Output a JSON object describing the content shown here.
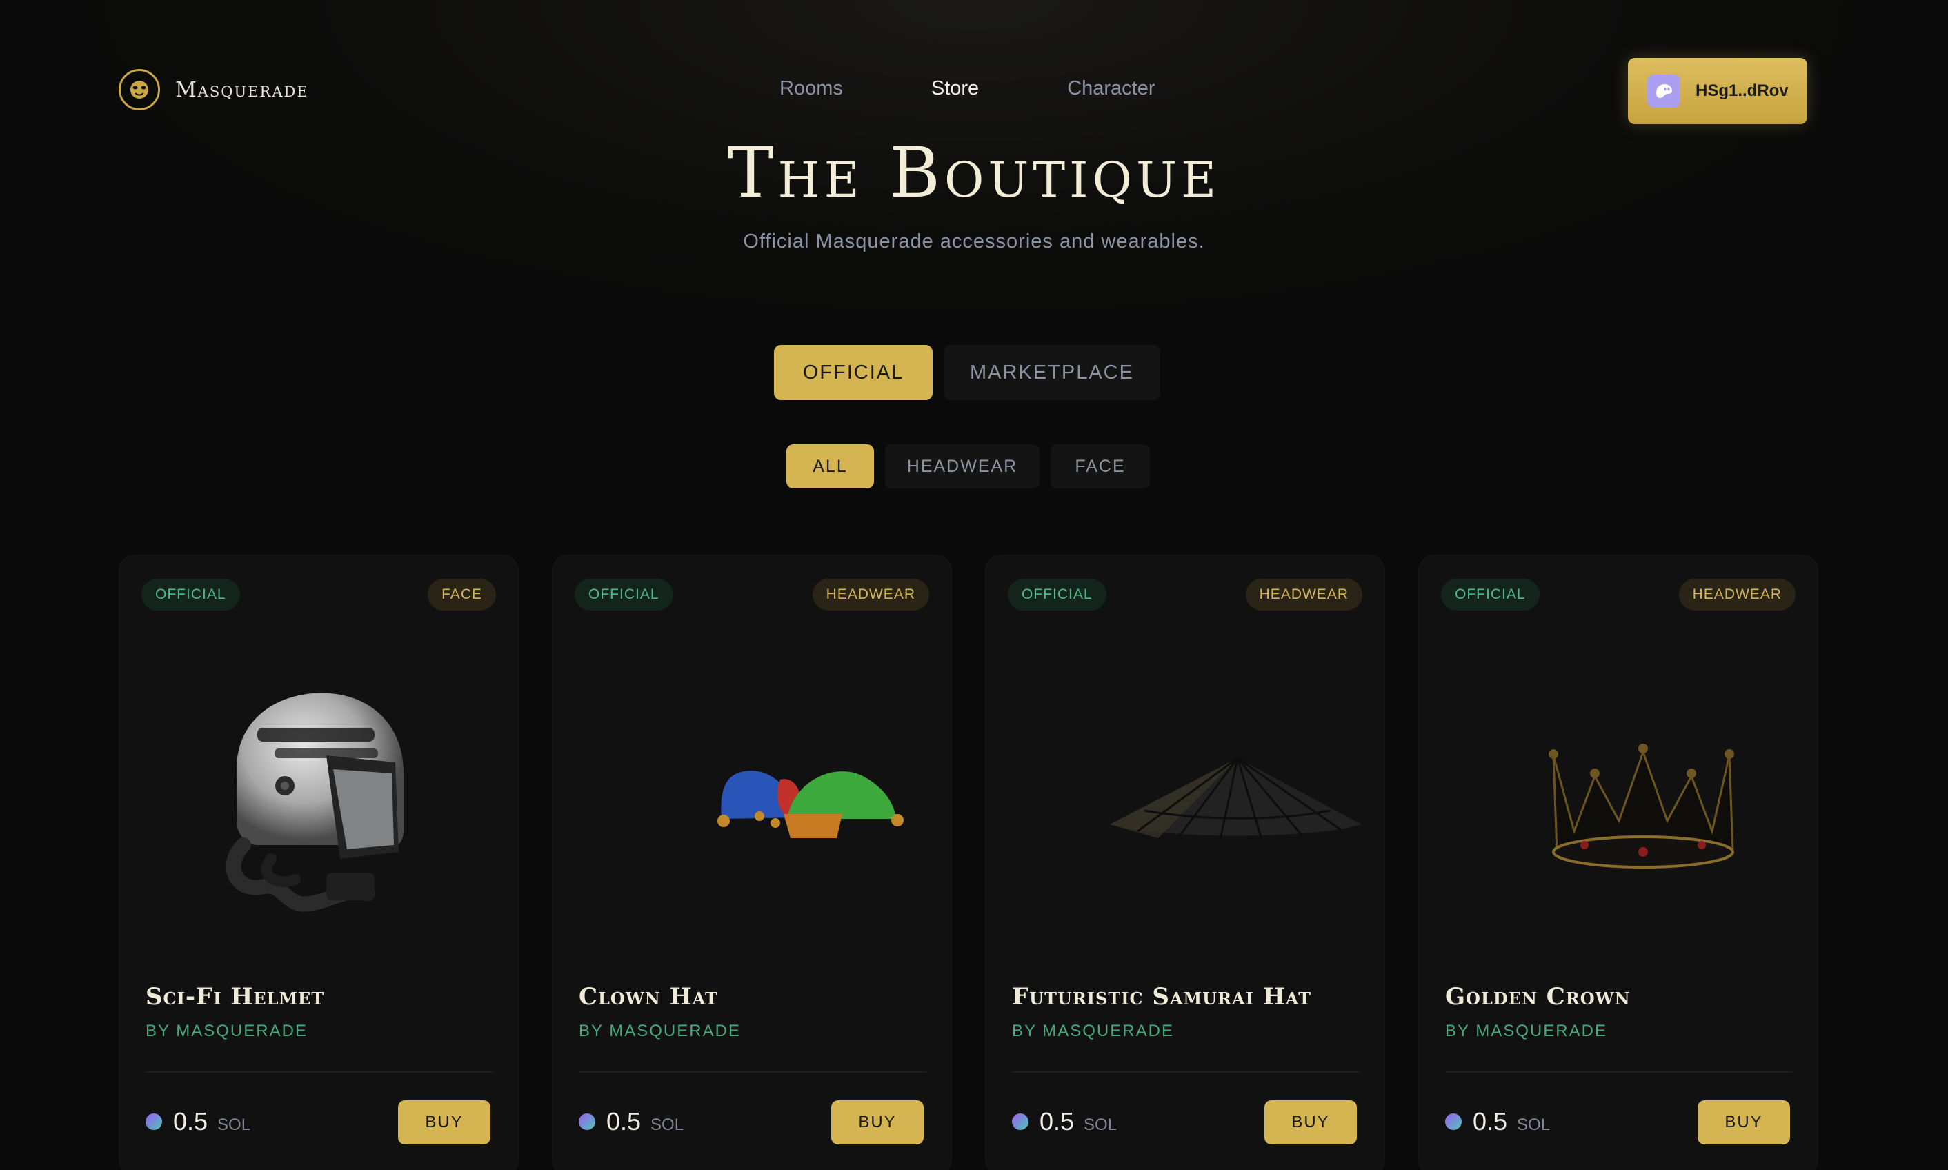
{
  "brand": {
    "name": "Masquerade"
  },
  "nav": {
    "items": [
      "Rooms",
      "Store",
      "Character"
    ],
    "active": "Store"
  },
  "wallet": {
    "label": "HSg1..dRov",
    "icon": "phantom-ghost-icon"
  },
  "hero": {
    "title": "The Boutique",
    "subtitle": "Official Masquerade accessories and wearables."
  },
  "tabs": [
    {
      "label": "OFFICIAL",
      "active": true
    },
    {
      "label": "MARKETPLACE",
      "active": false
    }
  ],
  "filters": [
    {
      "label": "ALL",
      "active": true
    },
    {
      "label": "HEADWEAR",
      "active": false
    },
    {
      "label": "FACE",
      "active": false
    }
  ],
  "products": [
    {
      "badge": "OFFICIAL",
      "category": "FACE",
      "name": "Sci-Fi Helmet",
      "creator": "BY MASQUERADE",
      "price": "0.5",
      "currency": "SOL",
      "action": "BUY"
    },
    {
      "badge": "OFFICIAL",
      "category": "HEADWEAR",
      "name": "Clown Hat",
      "creator": "BY MASQUERADE",
      "price": "0.5",
      "currency": "SOL",
      "action": "BUY"
    },
    {
      "badge": "OFFICIAL",
      "category": "HEADWEAR",
      "name": "Futuristic Samurai Hat",
      "creator": "BY MASQUERADE",
      "price": "0.5",
      "currency": "SOL",
      "action": "BUY"
    },
    {
      "badge": "OFFICIAL",
      "category": "HEADWEAR",
      "name": "Golden Crown",
      "creator": "BY MASQUERADE",
      "price": "0.5",
      "currency": "SOL",
      "action": "BUY"
    }
  ],
  "colors": {
    "background": "#0b0b0b",
    "accent_gold": "#d4b551",
    "official_green": "#4fb889",
    "muted_text": "#8a93a3"
  }
}
